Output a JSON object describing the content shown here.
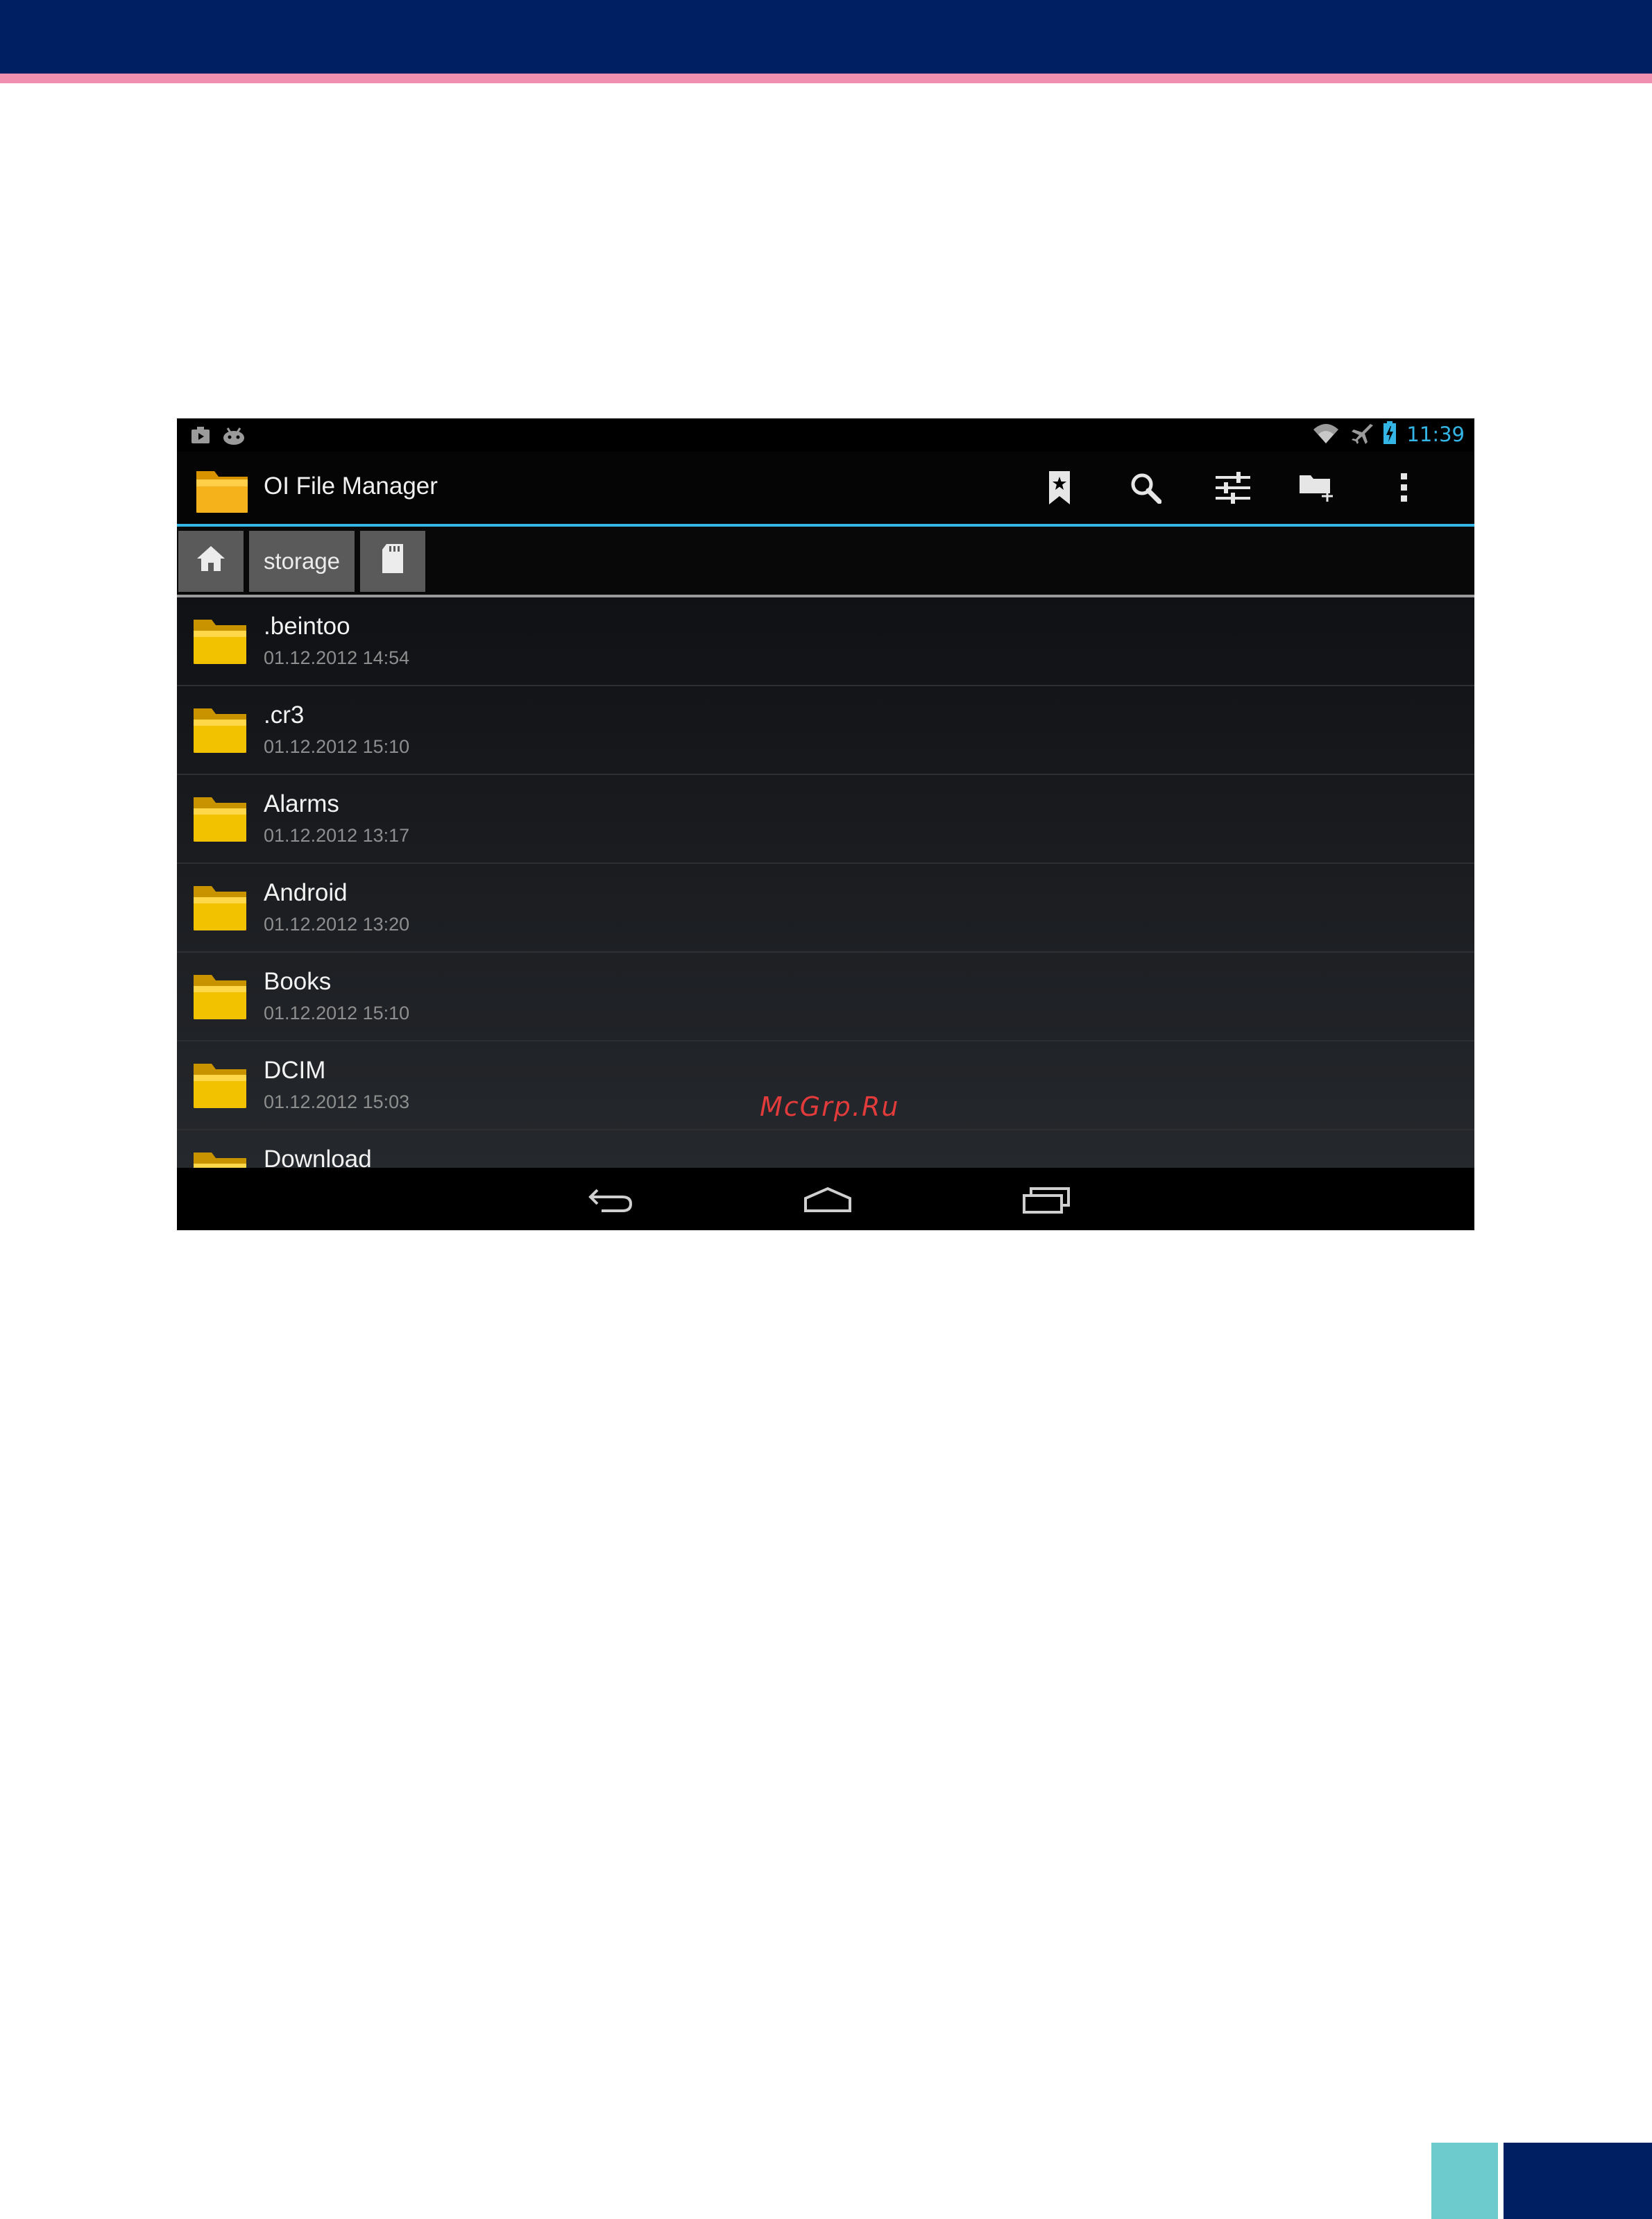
{
  "app": {
    "title": "OI File Manager"
  },
  "status_bar": {
    "time": "11:39",
    "left_icons": [
      "camera-icon",
      "android-debug-icon"
    ],
    "right_icons": [
      "wifi-icon",
      "airplane-icon",
      "battery-charging-icon"
    ]
  },
  "action_bar": {
    "actions": [
      "bookmark-icon",
      "search-icon",
      "settings-sliders-icon",
      "new-folder-icon",
      "overflow-menu-icon"
    ]
  },
  "breadcrumb": {
    "home": "home-icon",
    "segments": [
      "storage"
    ],
    "current": "sd-card-icon"
  },
  "files": [
    {
      "name": ".beintoo",
      "date": "01.12.2012 14:54"
    },
    {
      "name": ".cr3",
      "date": "01.12.2012 15:10"
    },
    {
      "name": "Alarms",
      "date": "01.12.2012 13:17"
    },
    {
      "name": "Android",
      "date": "01.12.2012 13:20"
    },
    {
      "name": "Books",
      "date": "01.12.2012 15:10"
    },
    {
      "name": "DCIM",
      "date": "01.12.2012 15:03"
    },
    {
      "name": "Download",
      "date": ""
    }
  ],
  "watermark": "McGrp.Ru",
  "nav_bar": [
    "back-icon",
    "home-nav-icon",
    "recent-apps-icon"
  ],
  "colors": {
    "header_band": "#001f63",
    "header_stripe": "#f08fb0",
    "accent_blue": "#33b5e5",
    "corner_teal": "#6ecbcd",
    "folder_yellow": "#f2c200"
  }
}
